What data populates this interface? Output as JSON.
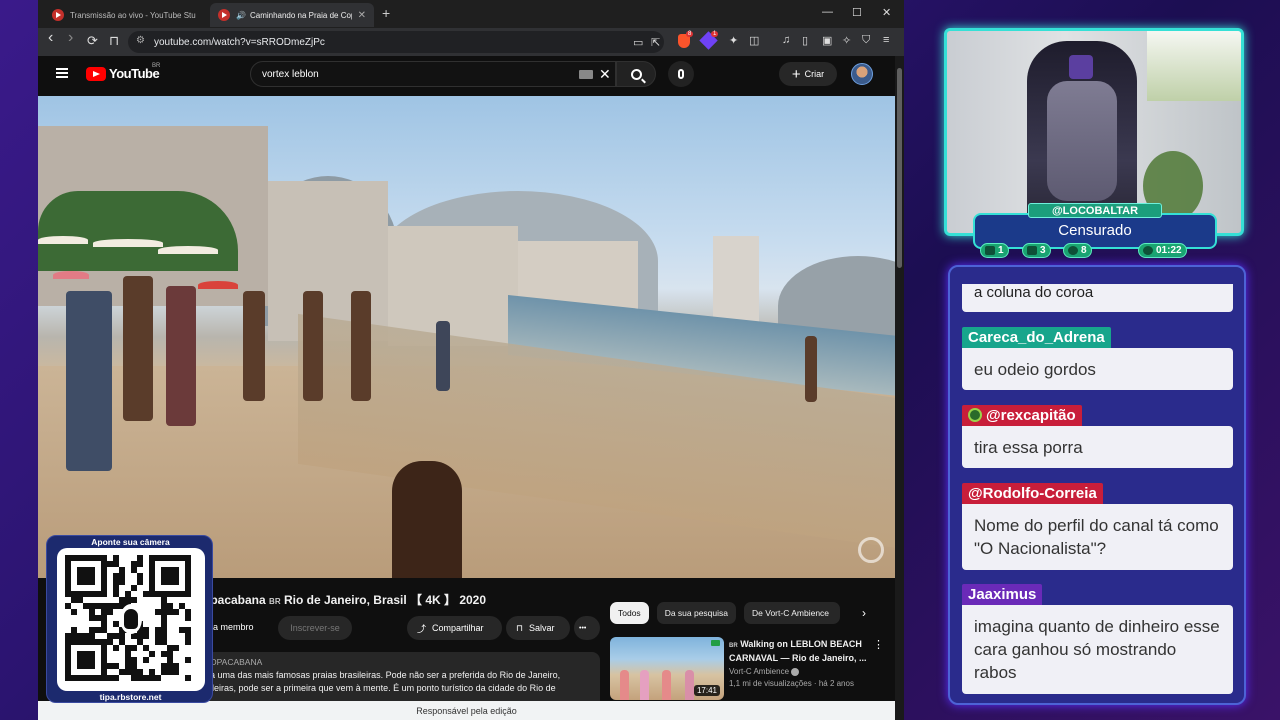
{
  "browser": {
    "tabs": [
      {
        "title": "Transmissão ao vivo - YouTube Studio",
        "active": false
      },
      {
        "title": "Caminhando na Praia de Copacabana",
        "active": true
      }
    ],
    "new_tab": "+",
    "window_controls": {
      "minimize": "—",
      "maximize": "☐",
      "close": "✕"
    },
    "nav": {
      "back": "‹",
      "forward": "›",
      "reload": "⟳",
      "bookmark": "⊓"
    },
    "url": "youtube.com/watch?v=sRRODmeZjPc",
    "brave_badge": "8",
    "rewards_badge": "1",
    "toolbar_icons": [
      "cast-icon",
      "share-icon",
      "extensions-icon",
      "screenshot-icon",
      "music-icon",
      "sidebar-icon",
      "wallet-icon",
      "leo-icon",
      "vpn-icon",
      "menu-icon"
    ],
    "statusbar": "Responsável pela edição"
  },
  "youtube": {
    "logo_text": "YouTube",
    "logo_region": "BR",
    "search_value": "vortex leblon",
    "clear": "✕",
    "create_label": "Criar",
    "create_plus": "+",
    "video": {
      "title_prefix": "opacabana",
      "title_flag": "BR",
      "title_rest": "Rio de Janeiro, Brasil 【 4K 】 2020",
      "join_label": "eja membro",
      "subscribe_label": "Inscrever-se",
      "share_label": "Compartilhar",
      "save_label": "Salvar",
      "more": "•••",
      "description_channel": "OPACABANA",
      "description_line1": "a uma das mais famosas praias brasileiras. Pode não ser a preferida do Rio de Janeiro,",
      "description_line2": "ileiras, pode ser a primeira que vem à mente. É um ponto turístico da cidade do Rio de"
    },
    "chips": [
      "Todos",
      "Da sua pesquisa",
      "De Vort-C Ambience"
    ],
    "chip_next": "›",
    "recommended": {
      "flag": "BR",
      "title": "Walking on LEBLON BEACH CARNAVAL — Rio de Janeiro, ...",
      "channel": "Vort-C Ambience",
      "meta": "1,1 mi de visualizações · há 2 anos",
      "duration": "17:41",
      "more": "⋮"
    }
  },
  "qr_overlay": {
    "header": "Aponte sua câmera",
    "footer": "tipa.rbstore.net"
  },
  "stream": {
    "username": "@LOCOBALTAR",
    "status": "Censurado",
    "stats": [
      {
        "icon": "twitch-icon",
        "value": "1"
      },
      {
        "icon": "youtube-icon",
        "value": "3"
      },
      {
        "icon": "kick-icon",
        "value": "8"
      },
      {
        "icon": "clock-icon",
        "value": "01:22"
      }
    ],
    "colors": {
      "accent": "#35e0d6",
      "panel": "#2a2b8c",
      "name_teal": "#1c9e7c"
    }
  },
  "chat": {
    "partial_message": "a coluna do coroa",
    "messages": [
      {
        "user": "Careca_do_Adrena",
        "color": "#17a58c",
        "text": "eu odeio gordos"
      },
      {
        "user": "@rexcapitão",
        "color": "#c81e3a",
        "text": "tira essa porra",
        "has_icon": true
      },
      {
        "user": "@Rodolfo-Correia",
        "color": "#c81e3a",
        "text": "Nome do perfil do canal tá como \"O Nacionalista\"?"
      },
      {
        "user": "Jaaximus",
        "color": "#6a2ab8",
        "text": "imagina quanto de dinheiro esse cara ganhou só mostrando rabos"
      }
    ]
  }
}
